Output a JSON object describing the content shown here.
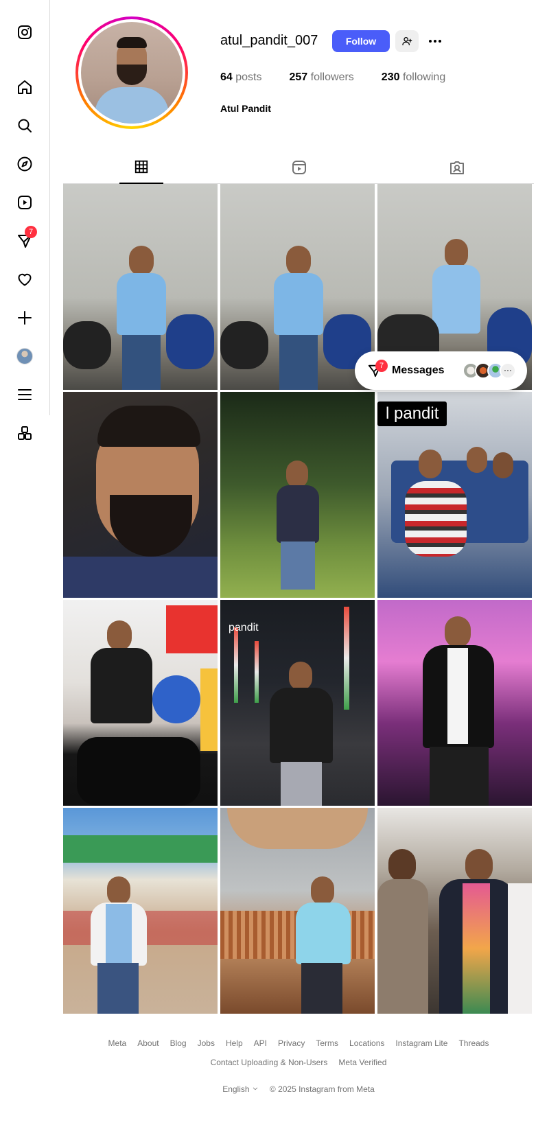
{
  "sidebar": {
    "notification_badge": "7",
    "items": [
      {
        "icon": "instagram-logo-icon"
      },
      {
        "icon": "home-icon"
      },
      {
        "icon": "search-icon"
      },
      {
        "icon": "explore-icon"
      },
      {
        "icon": "reels-icon"
      },
      {
        "icon": "messages-icon"
      },
      {
        "icon": "heart-icon"
      },
      {
        "icon": "plus-icon"
      },
      {
        "icon": "profile-avatar"
      },
      {
        "icon": "menu-icon"
      },
      {
        "icon": "also-from-meta-icon"
      }
    ]
  },
  "profile": {
    "username": "atul_pandit_007",
    "follow_label": "Follow",
    "posts_count": "64",
    "posts_label": "posts",
    "followers_count": "257",
    "followers_label": "followers",
    "following_count": "230",
    "following_label": "following",
    "full_name": "Atul Pandit"
  },
  "tabs": [
    {
      "icon": "grid-icon",
      "active": true
    },
    {
      "icon": "reels-icon",
      "active": false
    },
    {
      "icon": "tagged-icon",
      "active": false
    }
  ],
  "grid_captions": {
    "post6": "l pandit",
    "post8": "pandit"
  },
  "messages_widget": {
    "label": "Messages",
    "badge": "7"
  },
  "footer": {
    "links": [
      "Meta",
      "About",
      "Blog",
      "Jobs",
      "Help",
      "API",
      "Privacy",
      "Terms",
      "Locations",
      "Instagram Lite",
      "Threads"
    ],
    "links2": [
      "Contact Uploading & Non-Users",
      "Meta Verified"
    ],
    "language": "English",
    "copyright": "© 2025 Instagram from Meta"
  },
  "colors": {
    "accent": "#4a5df9",
    "badge": "#ff3040",
    "text_secondary": "#737373",
    "border": "#dbdbdb"
  }
}
